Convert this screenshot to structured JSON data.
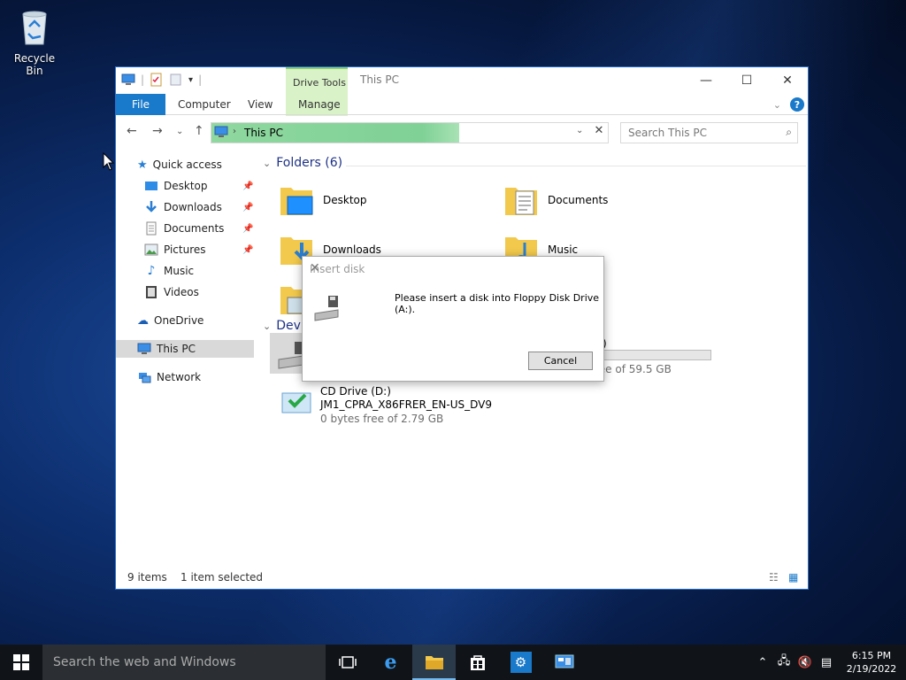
{
  "desktop": {
    "recycle_bin_label": "Recycle Bin"
  },
  "explorer": {
    "title": "This PC",
    "context_tab_group": "Drive Tools",
    "ribbon_tabs": {
      "file": "File",
      "computer": "Computer",
      "view": "View",
      "manage": "Manage"
    },
    "address": {
      "path": "This PC"
    },
    "search": {
      "placeholder": "Search This PC"
    },
    "nav_pane": {
      "quick_access": "Quick access",
      "desktop": "Desktop",
      "downloads": "Downloads",
      "documents": "Documents",
      "pictures": "Pictures",
      "music": "Music",
      "videos": "Videos",
      "onedrive": "OneDrive",
      "this_pc": "This PC",
      "network": "Network"
    },
    "folders_header": "Folders (6)",
    "folders": [
      "Desktop",
      "Documents",
      "Downloads",
      "Music"
    ],
    "devices_header_partial": "Devi",
    "drive_c": {
      "label_partial": ":)",
      "free_text": "51.4 GB free of 59.5 GB",
      "used_fraction": 0.14
    },
    "drive_d": {
      "name": "CD Drive (D:)",
      "label": "JM1_CPRA_X86FRER_EN-US_DV9",
      "free_text": "0 bytes free of 2.79 GB"
    },
    "status": {
      "items": "9 items",
      "selected": "1 item selected"
    }
  },
  "dialog": {
    "title": "Insert disk",
    "message": "Please insert a disk into Floppy Disk Drive (A:).",
    "cancel": "Cancel"
  },
  "taskbar": {
    "search_placeholder": "Search the web and Windows",
    "time": "6:15 PM",
    "date": "2/19/2022"
  },
  "colors": {
    "accent": "#1979ca",
    "address_fill": "#7fd196",
    "drive_tools": "#d9f2c8"
  }
}
